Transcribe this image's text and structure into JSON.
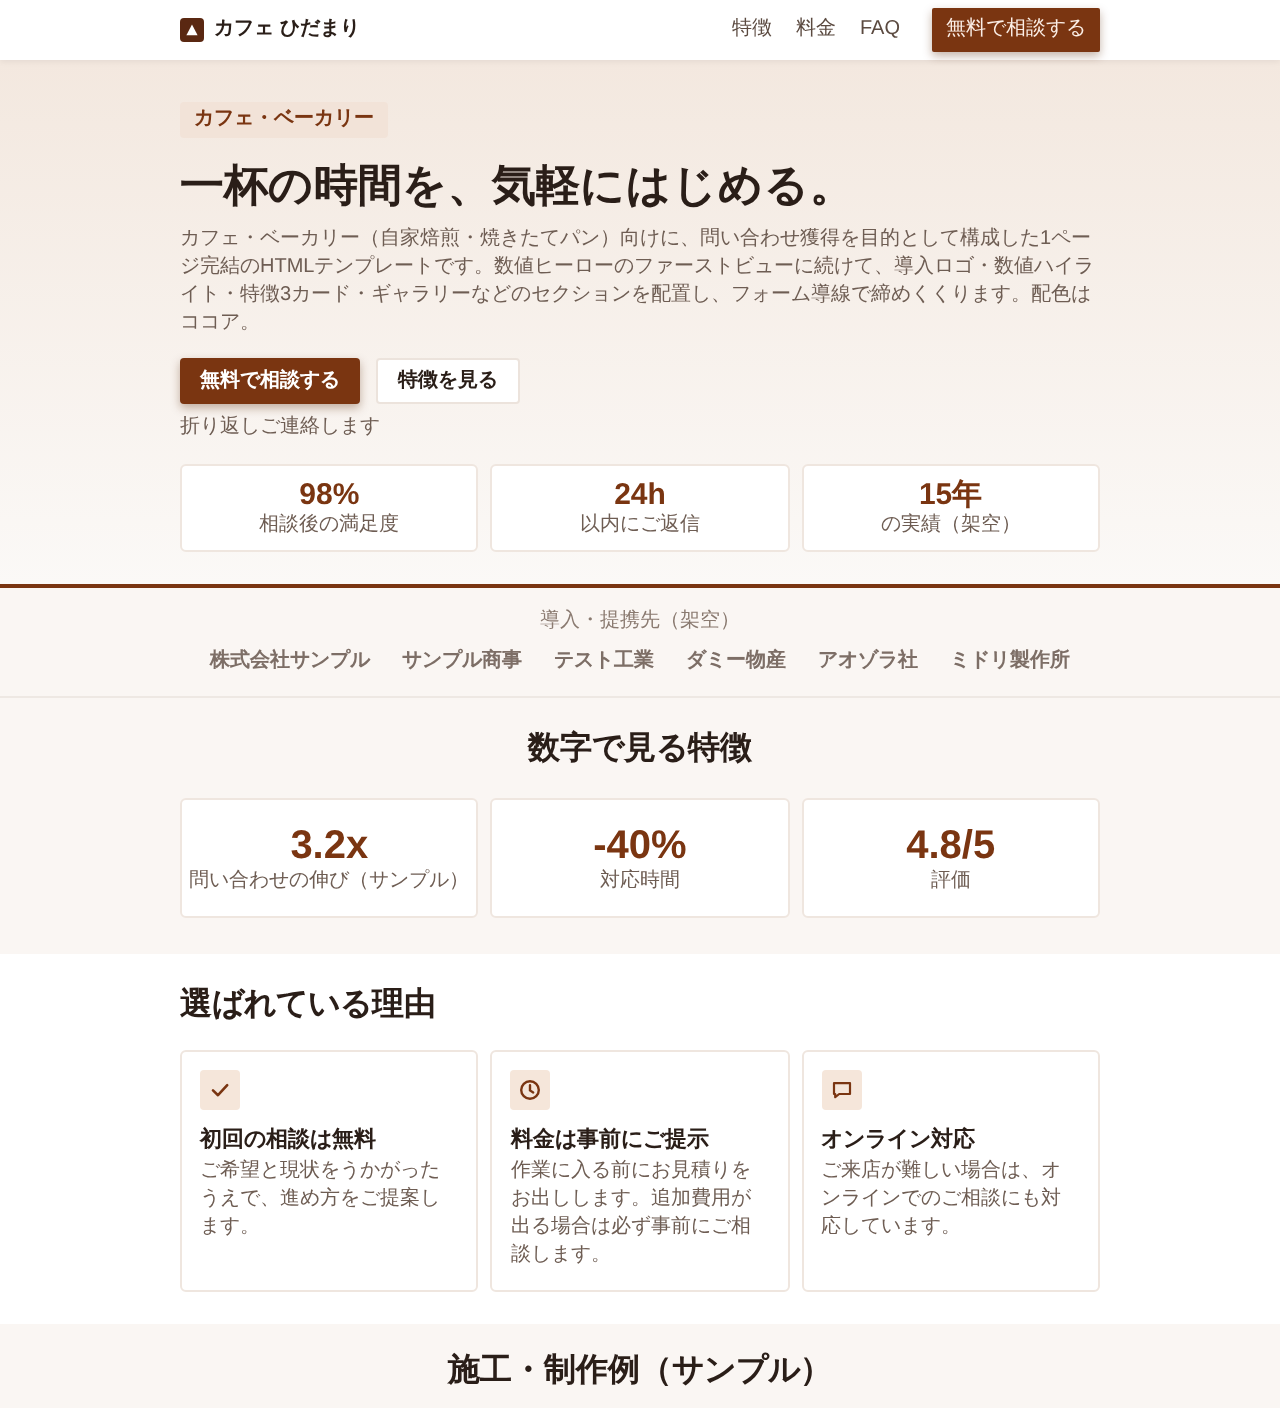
{
  "header": {
    "brand": "カフェ ひだまり",
    "nav": [
      "特徴",
      "料金",
      "FAQ"
    ],
    "cta": "無料で相談する"
  },
  "hero": {
    "tag": "カフェ・ベーカリー",
    "title": "一杯の時間を、気軽にはじめる。",
    "description": "カフェ・ベーカリー（自家焙煎・焼きたてパン）向けに、問い合わせ獲得を目的として構成した1ページ完結のHTMLテンプレートです。数値ヒーローのファーストビューに続けて、導入ロゴ・数値ハイライト・特徴3カード・ギャラリーなどのセクションを配置し、フォーム導線で締めくくります。配色はココア。",
    "buttons": [
      {
        "label": "無料で相談する",
        "kind": "primary"
      },
      {
        "label": "特徴を見る",
        "kind": "secondary"
      }
    ],
    "note": "折り返しご連絡します",
    "stats": [
      {
        "value": "98%",
        "label": "相談後の満足度"
      },
      {
        "value": "24h",
        "label": "以内にご返信"
      },
      {
        "value": "15年",
        "label": "の実績（架空）"
      }
    ]
  },
  "partners": {
    "label": "導入・提携先（架空）",
    "names": [
      "株式会社サンプル",
      "サンプル商事",
      "テスト工業",
      "ダミー物産",
      "アオゾラ社",
      "ミドリ製作所"
    ]
  },
  "highlights": {
    "title": "数字で見る特徴",
    "items": [
      {
        "value": "3.2x",
        "label": "問い合わせの伸び（サンプル）"
      },
      {
        "value": "-40%",
        "label": "対応時間"
      },
      {
        "value": "4.8/5",
        "label": "評価"
      }
    ]
  },
  "reasons": {
    "title": "選ばれている理由",
    "items": [
      {
        "title": "初回の相談は無料",
        "text": "ご希望と現状をうかがったうえで、進め方をご提案します。"
      },
      {
        "title": "料金は事前にご提示",
        "text": "作業に入る前にお見積りをお出しします。追加費用が出る場合は必ず事前にご相談します。"
      },
      {
        "title": "オンライン対応",
        "text": "ご来店が難しい場合は、オンラインでのご相談にも対応しています。"
      }
    ]
  },
  "gallery": {
    "title": "施工・制作例（サンプル）"
  }
}
